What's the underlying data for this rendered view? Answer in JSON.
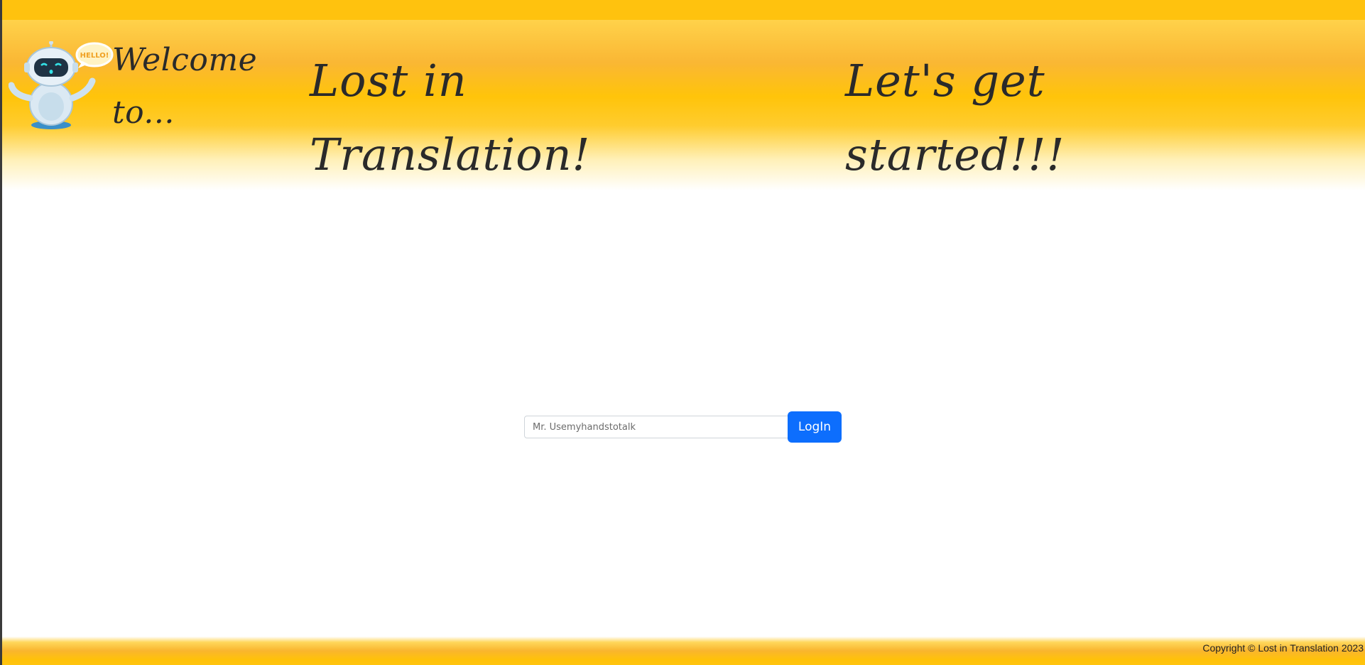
{
  "header": {
    "welcome_text": "Welcome to...",
    "brand_title": "Lost in Translation!",
    "tagline": "Let's get started!!!",
    "robot_badge_text": "HELLO!"
  },
  "login": {
    "input_value": "",
    "input_placeholder": "Mr. Usemyhandstotalk",
    "button_label": "LogIn"
  },
  "footer": {
    "copyright": "Copyright © Lost in Translation 2023"
  },
  "colors": {
    "header_yellow": "#ffc20e",
    "header_orange": "#fab734",
    "button_blue": "#0d6efd",
    "text_dark": "#2a2a2a"
  },
  "icons": {
    "robot": "robot-mascot-icon"
  }
}
